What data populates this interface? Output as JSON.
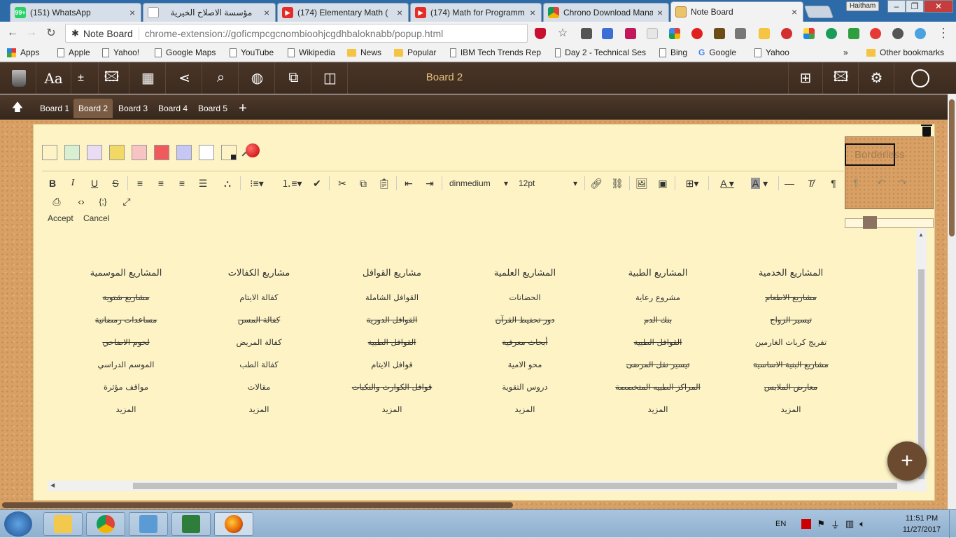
{
  "browser": {
    "tabs": [
      {
        "label": "(151) WhatsApp",
        "favicon": "whatsapp-icon",
        "color": "#25d366",
        "badge": "99+"
      },
      {
        "label": "مؤسسة الاصلاح الخيرية",
        "favicon": "page-icon",
        "color": "#ffffff",
        "badge": ""
      },
      {
        "label": "(174) Elementary Math (",
        "favicon": "youtube-icon",
        "color": "#e52d27",
        "badge": ""
      },
      {
        "label": "(174) Math for Programm",
        "favicon": "youtube-icon",
        "color": "#e52d27",
        "badge": ""
      },
      {
        "label": "Chrono Download Mana",
        "favicon": "chrono-icon",
        "color": "#3c8d3c",
        "badge": ""
      },
      {
        "label": "Note Board",
        "favicon": "note-board-icon",
        "color": "#e9c46a",
        "badge": ""
      }
    ],
    "profile": "Haitham",
    "omnibox": {
      "chip": "Note Board",
      "url": "chrome-extension://goficmpcgcnombioohjcgdhbaloknabb/popup.html"
    },
    "bookmarks": [
      {
        "label": "Apps",
        "kind": "apps"
      },
      {
        "label": "Apple",
        "kind": "page"
      },
      {
        "label": "Yahoo!",
        "kind": "page"
      },
      {
        "label": "Google Maps",
        "kind": "page"
      },
      {
        "label": "YouTube",
        "kind": "page"
      },
      {
        "label": "Wikipedia",
        "kind": "page"
      },
      {
        "label": "News",
        "kind": "folder"
      },
      {
        "label": "Popular",
        "kind": "folder"
      },
      {
        "label": "IBM Tech Trends Rep",
        "kind": "page"
      },
      {
        "label": "Day 2 - Technical Ses",
        "kind": "page"
      },
      {
        "label": "Bing",
        "kind": "page"
      },
      {
        "label": "Google",
        "kind": "google"
      },
      {
        "label": "Yahoo",
        "kind": "page"
      }
    ],
    "bookmarks_more": "»",
    "other_bookmarks": "Other bookmarks"
  },
  "app": {
    "board_title": "Board 2",
    "toolbar_icons": [
      "trash-icon",
      "font-icon",
      "zoom-icon",
      "image-icon",
      "boards-icon",
      "share-icon",
      "search-icon",
      "globe-icon",
      "windows-icon",
      "layout-icon"
    ],
    "font_glyph": "Aa",
    "right_icons": [
      "add-note-icon",
      "add-image-icon",
      "gear-icon",
      "user-icon"
    ],
    "board_tabs": [
      "Board 1",
      "Board 2",
      "Board 3",
      "Board 4",
      "Board 5"
    ],
    "active_board_index": 1,
    "add_board": "+",
    "up_arrow": "🡅"
  },
  "note": {
    "colors": [
      "#fdf3c4",
      "#d7f0d2",
      "#eadcf2",
      "#f2d966",
      "#f8c3c3",
      "#f05a5a",
      "#c7c7f5",
      "#ffffff",
      "#fdf3c4"
    ],
    "accent": "#6b4a2f",
    "borderless_label": "Borderless",
    "editor": {
      "font_name": "dinmedium",
      "font_size": "12pt",
      "accept": "Accept",
      "cancel": "Cancel"
    },
    "headers": [
      "المشاريع الخدمية",
      "المشاريع الطبية",
      "المشاريع العلمية",
      "مشاريع القوافل",
      "مشاريع الكفالات",
      "المشاريع الموسمية"
    ],
    "rows": [
      [
        {
          "text": "مشاريع الاطعام",
          "strike": true
        },
        {
          "text": "مشروع رعاية",
          "strike": false
        },
        {
          "text": "الحضانات",
          "strike": false
        },
        {
          "text": "القوافل الشاملة",
          "strike": false
        },
        {
          "text": "كفالة الايتام",
          "strike": false
        },
        {
          "text": "مشاريع شتوية",
          "strike": true
        }
      ],
      [
        {
          "text": "تيسير الزواج",
          "strike": true
        },
        {
          "text": "بنك الدم",
          "strike": true
        },
        {
          "text": "دور تحفيظ القرآن",
          "strike": true
        },
        {
          "text": "القوافل الدورية",
          "strike": true
        },
        {
          "text": "كفالة المسن",
          "strike": true
        },
        {
          "text": "مساعدات رمضانية",
          "strike": true
        }
      ],
      [
        {
          "text": "تفريج كربات الغارمين",
          "strike": false
        },
        {
          "text": "القوافل الطبية",
          "strike": true
        },
        {
          "text": "أبحاث معرفية",
          "strike": true
        },
        {
          "text": "القوافل الطبية",
          "strike": true
        },
        {
          "text": "كفالة المريض",
          "strike": false
        },
        {
          "text": "لحوم الاضاحي",
          "strike": true
        }
      ],
      [
        {
          "text": "مشاريع البنية الاساسية",
          "strike": true
        },
        {
          "text": "تيسير نقل المرضى",
          "strike": true
        },
        {
          "text": "محو الامية",
          "strike": false
        },
        {
          "text": "قوافل الايتام",
          "strike": false
        },
        {
          "text": "كفالة الطب",
          "strike": false
        },
        {
          "text": "الموسم الدراسي",
          "strike": false
        }
      ],
      [
        {
          "text": "معارض الملابس",
          "strike": true
        },
        {
          "text": "المراكز الطبيه المتخصصة",
          "strike": true
        },
        {
          "text": "دروس التقوية",
          "strike": false
        },
        {
          "text": "قوافل الكوارث والنكبات",
          "strike": true
        },
        {
          "text": "مقالات",
          "strike": false
        },
        {
          "text": "مواقف مؤثرة",
          "strike": false
        }
      ],
      [
        {
          "text": "المزيد",
          "strike": false
        },
        {
          "text": "المزيد",
          "strike": false
        },
        {
          "text": "المزيد",
          "strike": false
        },
        {
          "text": "المزيد",
          "strike": false
        },
        {
          "text": "المزيد",
          "strike": false
        },
        {
          "text": "المزيد",
          "strike": false
        }
      ]
    ],
    "fab": "+"
  },
  "taskbar": {
    "items": [
      "explorer-icon",
      "chrome-icon",
      "control-panel-icon",
      "task-manager-icon",
      "firefox-icon"
    ],
    "language": "EN",
    "time": "11:51 PM",
    "date": "11/27/2017"
  }
}
